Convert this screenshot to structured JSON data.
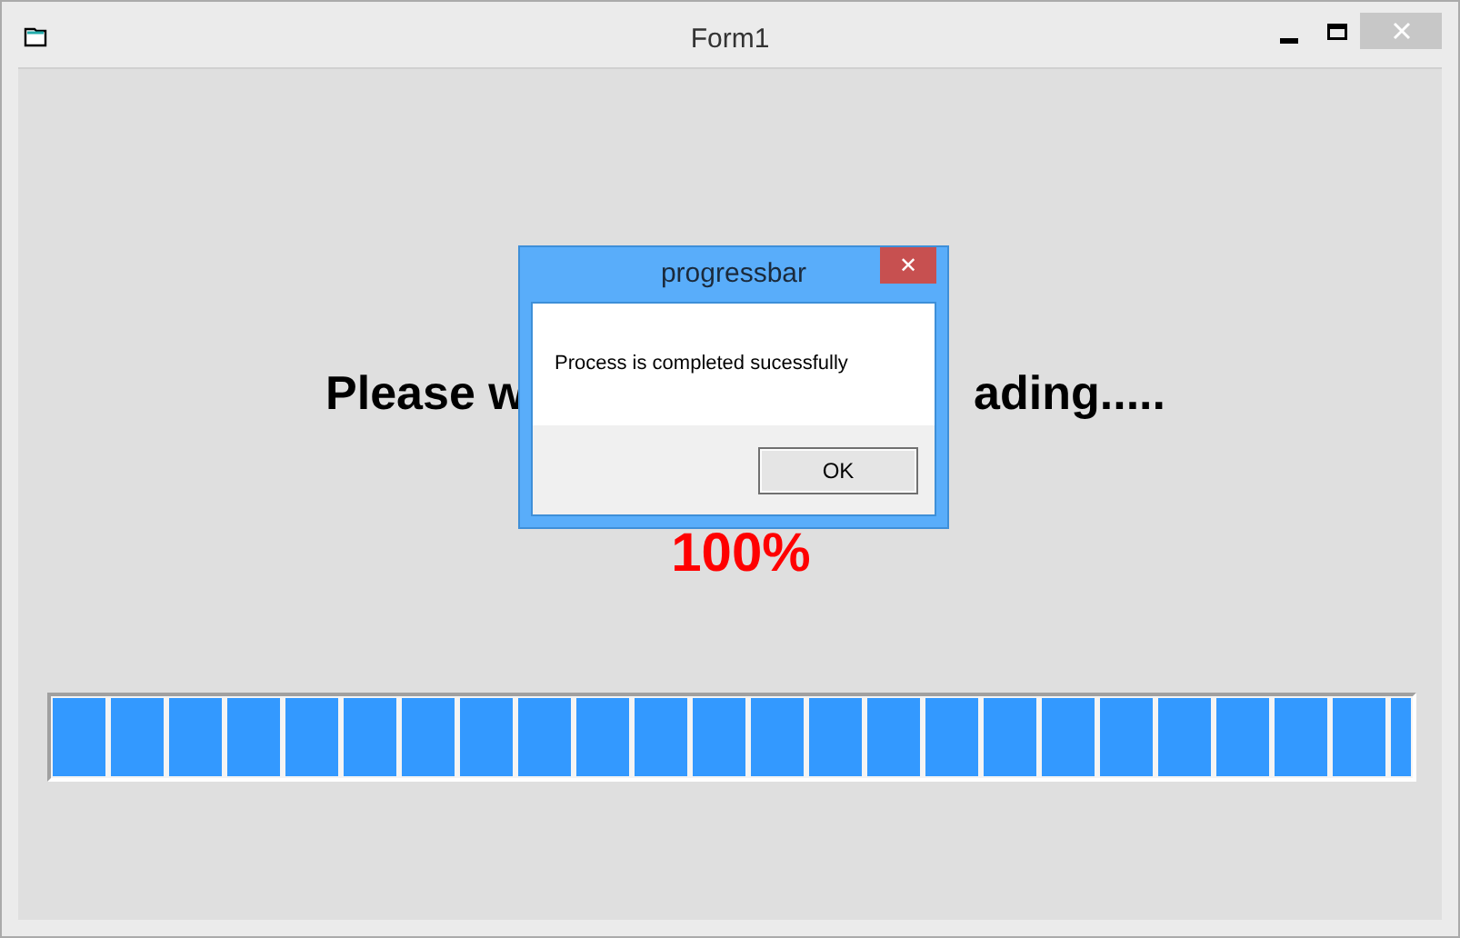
{
  "window": {
    "title": "Form1"
  },
  "heading": {
    "visible_left": "Please w",
    "visible_right": "ading....."
  },
  "percent": "100%",
  "progress": {
    "level": 1
  },
  "dialog": {
    "title": "progressbar",
    "close": "✕",
    "message": "Process is completed sucessfully",
    "button": "OK"
  }
}
